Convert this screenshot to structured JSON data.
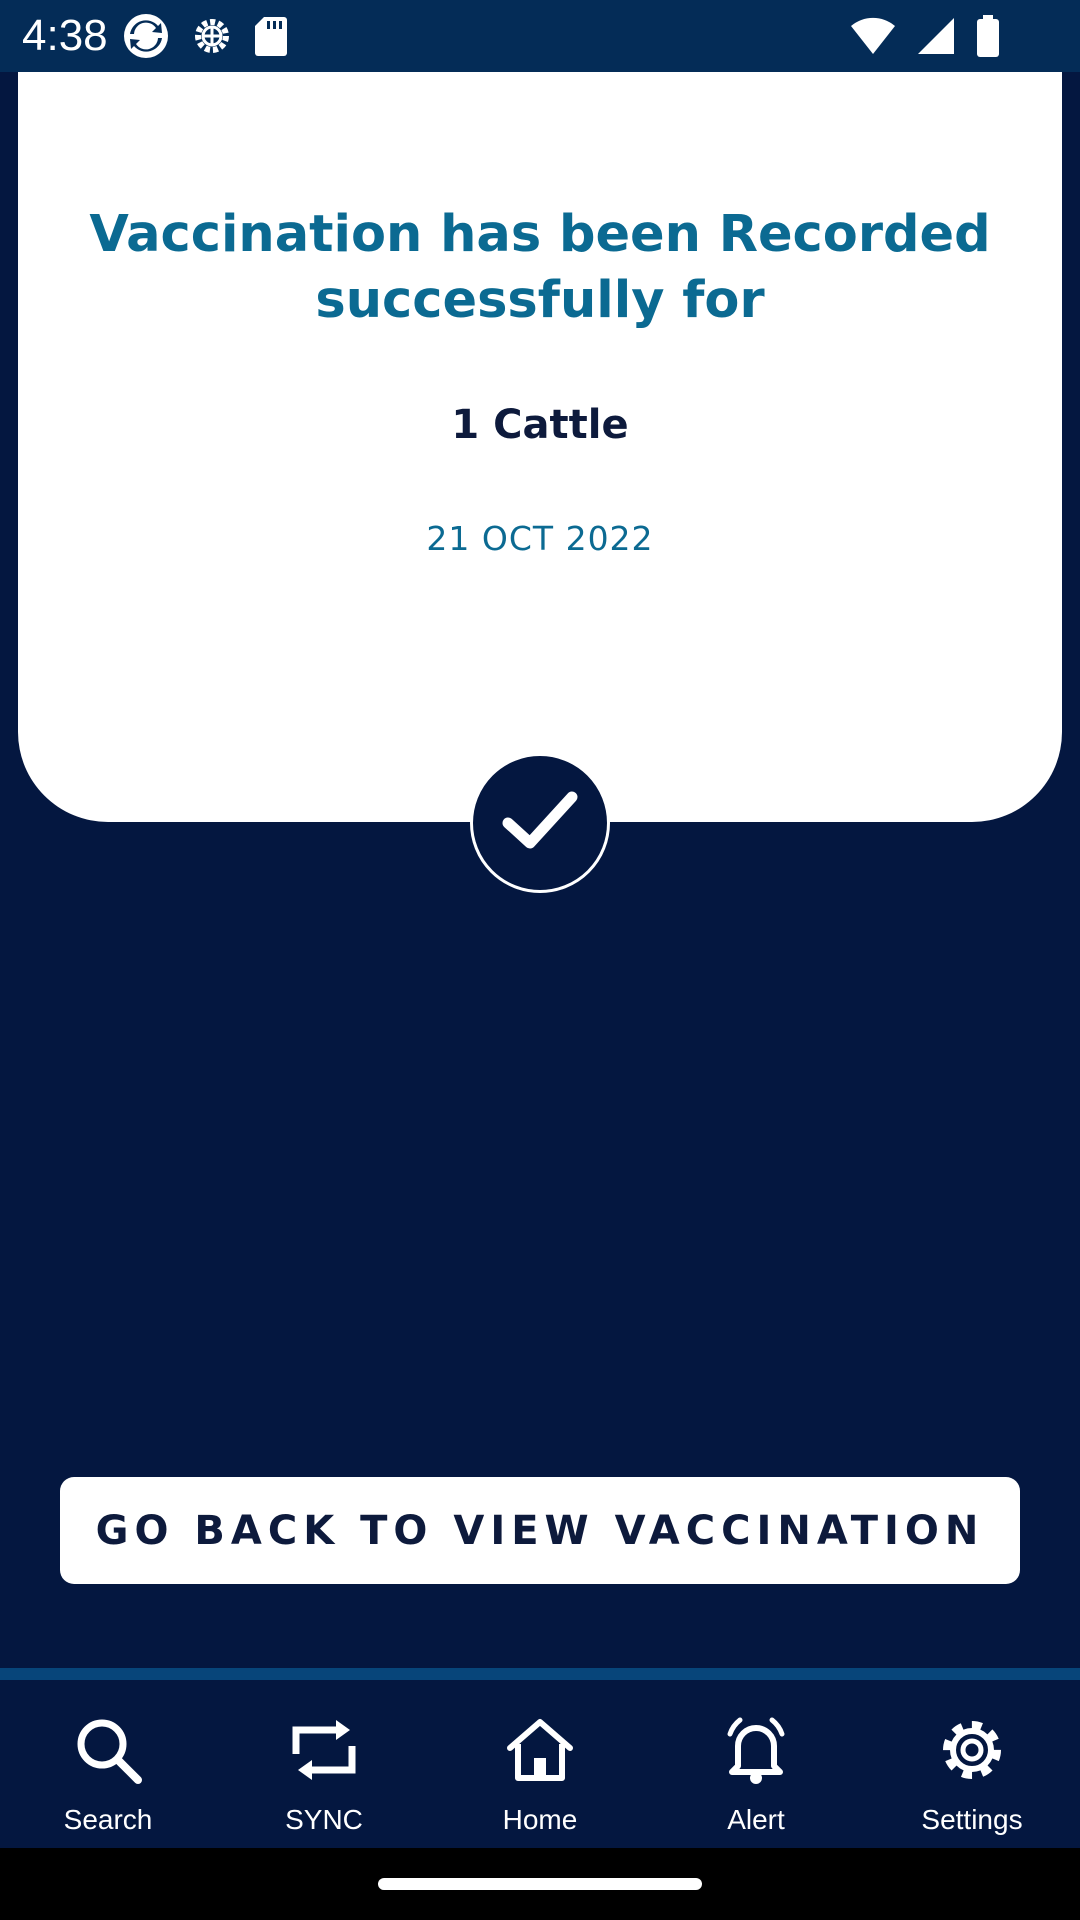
{
  "status_bar": {
    "time": "4:38",
    "left_icons": [
      "sync-app-icon",
      "gear-notification-icon",
      "sd-card-icon"
    ],
    "right_icons": [
      "wifi-icon",
      "cell-signal-icon",
      "battery-icon"
    ]
  },
  "confirmation": {
    "title": "Vaccination has been Recorded successfully for",
    "count": "1 Cattle",
    "date": "21 OCT 2022",
    "status_icon": "checkmark-icon"
  },
  "actions": {
    "go_back_label": "GO BACK TO VIEW VACCINATION"
  },
  "bottom_nav": {
    "items": [
      {
        "label": "Search",
        "icon": "search-icon"
      },
      {
        "label": "SYNC",
        "icon": "sync-icon"
      },
      {
        "label": "Home",
        "icon": "home-icon"
      },
      {
        "label": "Alert",
        "icon": "bell-icon"
      },
      {
        "label": "Settings",
        "icon": "gear-icon"
      }
    ]
  },
  "colors": {
    "background": "#041740",
    "status_bar": "#042c57",
    "accent_blue": "#0b6a92",
    "dark_text": "#0d1a3c"
  }
}
